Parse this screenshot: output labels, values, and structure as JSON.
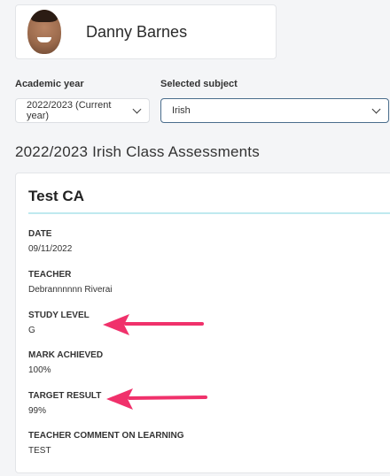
{
  "profile": {
    "name": "Danny Barnes"
  },
  "filters": {
    "academic_year": {
      "label": "Academic year",
      "value": "2022/2023 (Current year)"
    },
    "subject": {
      "label": "Selected subject",
      "value": "Irish"
    }
  },
  "section_title": "2022/2023 Irish Class Assessments",
  "assessment": {
    "title": "Test CA",
    "rows": [
      {
        "label": "DATE",
        "value": "09/11/2022"
      },
      {
        "label": "TEACHER",
        "value": "Debrannnnnn Riverai"
      },
      {
        "label": "STUDY LEVEL",
        "value": "G"
      },
      {
        "label": "MARK ACHIEVED",
        "value": "100%"
      },
      {
        "label": "TARGET RESULT",
        "value": "99%"
      },
      {
        "label": "TEACHER COMMENT ON LEARNING",
        "value": "TEST"
      }
    ]
  },
  "annotation_color": "#f0316b"
}
